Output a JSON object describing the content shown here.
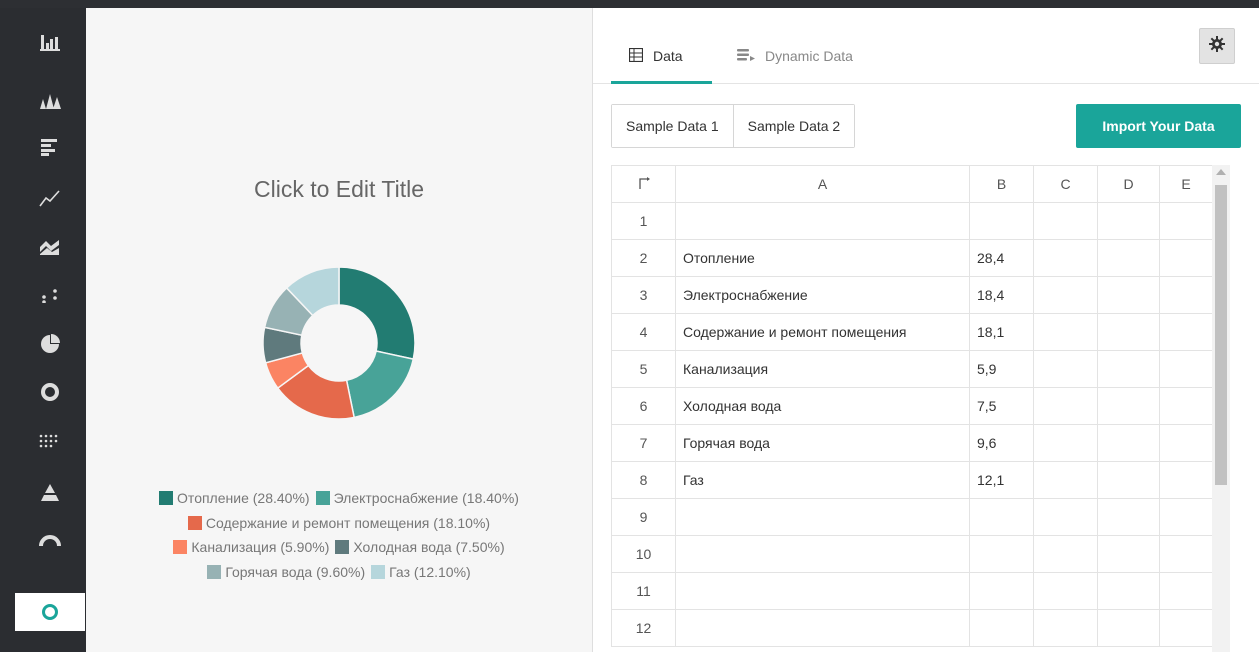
{
  "sidebar": {
    "items": [
      {
        "icon": "bar-chart-icon"
      },
      {
        "icon": "histogram-icon"
      },
      {
        "icon": "horizontal-bar-icon"
      },
      {
        "icon": "line-chart-icon"
      },
      {
        "icon": "area-chart-icon"
      },
      {
        "icon": "scatter-chart-icon"
      },
      {
        "icon": "pie-chart-icon"
      },
      {
        "icon": "donut-chart-icon"
      },
      {
        "icon": "dot-matrix-icon"
      },
      {
        "icon": "pyramid-icon"
      },
      {
        "icon": "gauge-icon"
      },
      {
        "icon": "ring-chart-icon",
        "active": true
      }
    ]
  },
  "chart": {
    "title": "Click to Edit Title"
  },
  "chart_data": {
    "type": "pie",
    "subtype": "donut",
    "title": "Click to Edit Title",
    "categories": [
      "Отопление",
      "Электроснабжение",
      "Содержание и ремонт помещения",
      "Канализация",
      "Холодная вода",
      "Горячая вода",
      "Газ"
    ],
    "values": [
      28.4,
      18.4,
      18.1,
      5.9,
      7.5,
      9.6,
      12.1
    ],
    "colors": [
      "#227c72",
      "#48a398",
      "#e5694b",
      "#fb8463",
      "#5f7a7d",
      "#97b2b4",
      "#b6d6dc"
    ],
    "legend": [
      "Отопление (28.40%)",
      "Электроснабжение (18.40%)",
      "Содержание и ремонт помещения (18.10%)",
      "Канализация (5.90%)",
      "Холодная вода (7.50%)",
      "Горячая вода (9.60%)",
      "Газ (12.10%)"
    ],
    "legend_position": "bottom"
  },
  "tabs": {
    "data_label": "Data",
    "dynamic_label": "Dynamic Data"
  },
  "buttons": {
    "sample1": "Sample Data 1",
    "sample2": "Sample Data 2",
    "import": "Import Your Data"
  },
  "grid": {
    "columns": [
      "A",
      "B",
      "C",
      "D",
      "E"
    ],
    "rows": [
      {
        "n": "1",
        "a": "",
        "b": ""
      },
      {
        "n": "2",
        "a": "Отопление",
        "b": "28,4"
      },
      {
        "n": "3",
        "a": "Электроснабжение",
        "b": "18,4"
      },
      {
        "n": "4",
        "a": "Содержание и ремонт помещения",
        "b": "18,1"
      },
      {
        "n": "5",
        "a": "Канализация",
        "b": "5,9"
      },
      {
        "n": "6",
        "a": "Холодная вода",
        "b": "7,5"
      },
      {
        "n": "7",
        "a": "Горячая вода",
        "b": "9,6"
      },
      {
        "n": "8",
        "a": "Газ",
        "b": "12,1"
      },
      {
        "n": "9",
        "a": "",
        "b": ""
      },
      {
        "n": "10",
        "a": "",
        "b": ""
      },
      {
        "n": "11",
        "a": "",
        "b": ""
      },
      {
        "n": "12",
        "a": "",
        "b": ""
      }
    ]
  },
  "colors": {
    "accent": "#1aa59a",
    "sidebar_bg": "#2b2d31",
    "chart_bg": "#f6f6f6"
  }
}
